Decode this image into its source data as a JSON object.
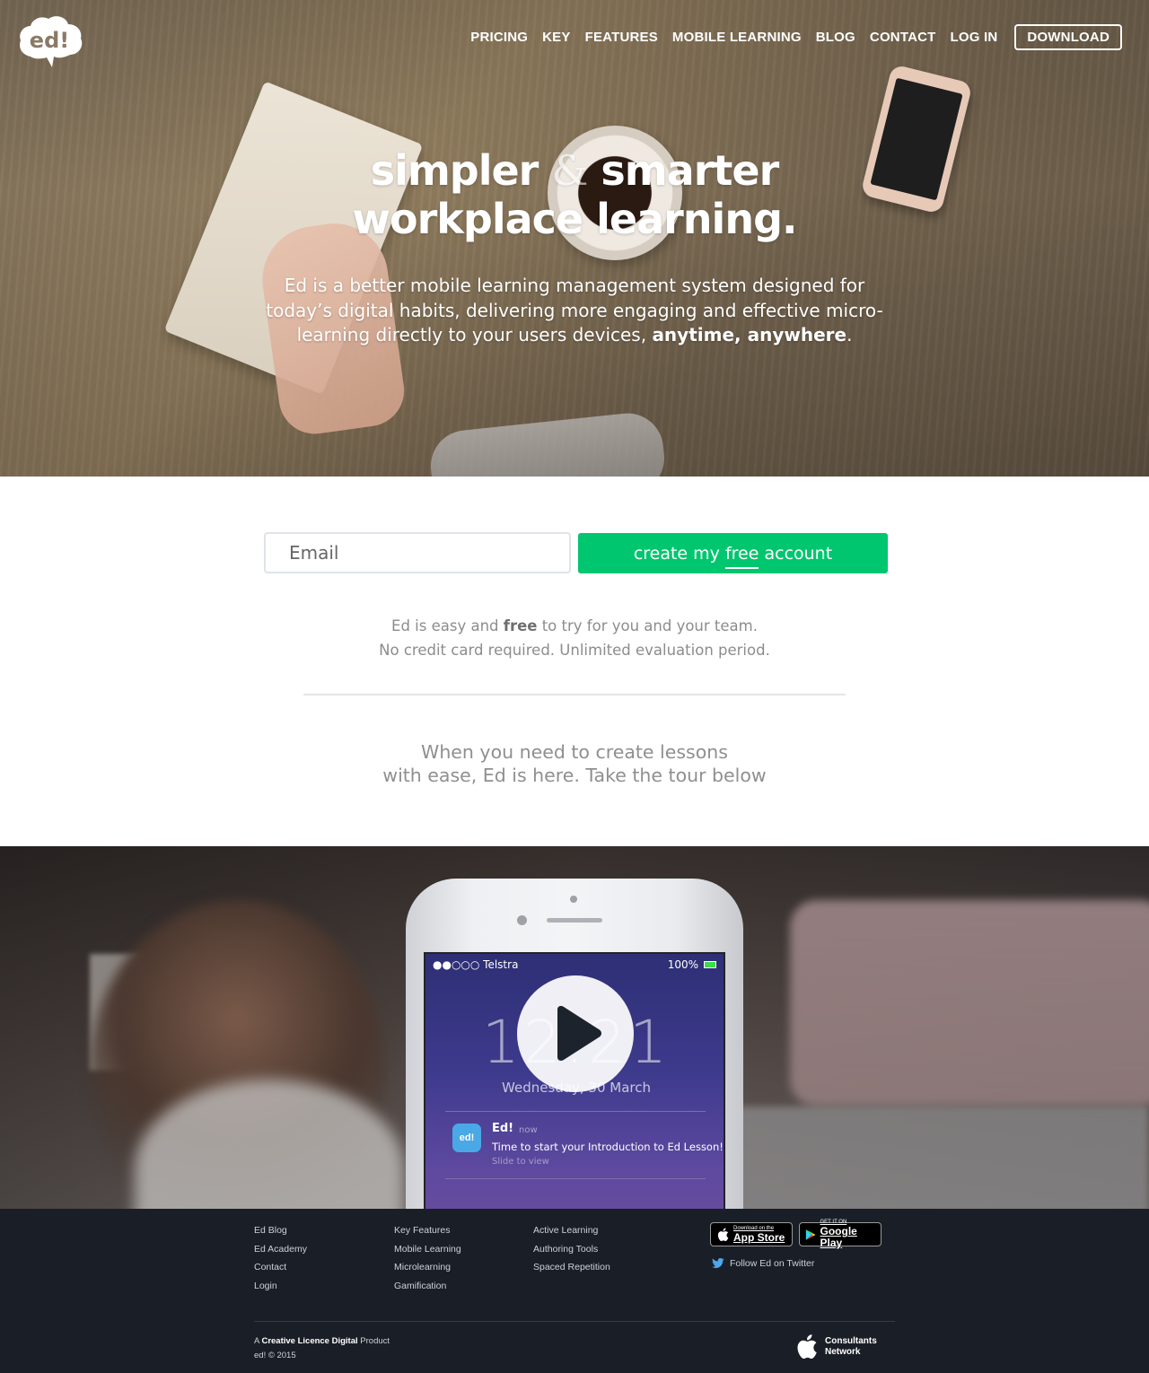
{
  "brand": {
    "logo_text": "ed!"
  },
  "nav": {
    "items": [
      "PRICING",
      "KEY",
      "FEATURES",
      "MOBILE LEARNING",
      "BLOG",
      "CONTACT",
      "LOG IN"
    ],
    "download": "DOWNLOAD"
  },
  "hero": {
    "title_part1": "simpler",
    "title_amp": "&",
    "title_part2": "smarter",
    "title_line2": "workplace learning.",
    "subtitle": "Ed is a better mobile learning management system designed for today’s digital habits, delivering more engaging and effective micro-learning directly to your users devices, ",
    "subtitle_bold": "anytime, anywhere",
    "subtitle_end": "."
  },
  "signup": {
    "email_placeholder": "Email",
    "cta_pre": "create my ",
    "cta_free": "free",
    "cta_post": " account",
    "note_line1_pre": "Ed is easy and ",
    "note_line1_bold": "free",
    "note_line1_post": " to try for you and your team.",
    "note_line2": "No credit card required. Unlimited evaluation period."
  },
  "tour": {
    "line1": "When you need to create lessons",
    "line2": "with ease, Ed is here. Take the tour below"
  },
  "video": {
    "carrier": "●●○○○ Telstra",
    "status_right": "100%",
    "clock": "12:21",
    "date": "Wednesday, 30 March",
    "notif_app": "Ed!",
    "notif_time": "now",
    "notif_text": "Time to start your Introduction to Ed Lesson!",
    "notif_slide": "Slide to view",
    "notif_icon_text": "ed!"
  },
  "footer": {
    "col1": [
      "Ed Blog",
      "Ed Academy",
      "Contact",
      "Login"
    ],
    "col2": [
      "Key Features",
      "Mobile Learning",
      "Microlearning",
      "Gamification"
    ],
    "col3": [
      "Active Learning",
      "Authoring Tools",
      "Spaced Repetition"
    ],
    "appstore_small": "Download on the",
    "appstore_big": "App Store",
    "googleplay_small": "GET IT ON",
    "googleplay_big": "Google Play",
    "twitter": "Follow Ed on Twitter",
    "credit_a": "A ",
    "credit_bold": "Creative Licence Digital",
    "credit_b": " Product",
    "copyright": "ed! © 2015",
    "acn_line1": "Consultants",
    "acn_line2": "Network"
  },
  "colors": {
    "accent_green": "#00c66f",
    "footer_bg": "#1a1f27"
  }
}
